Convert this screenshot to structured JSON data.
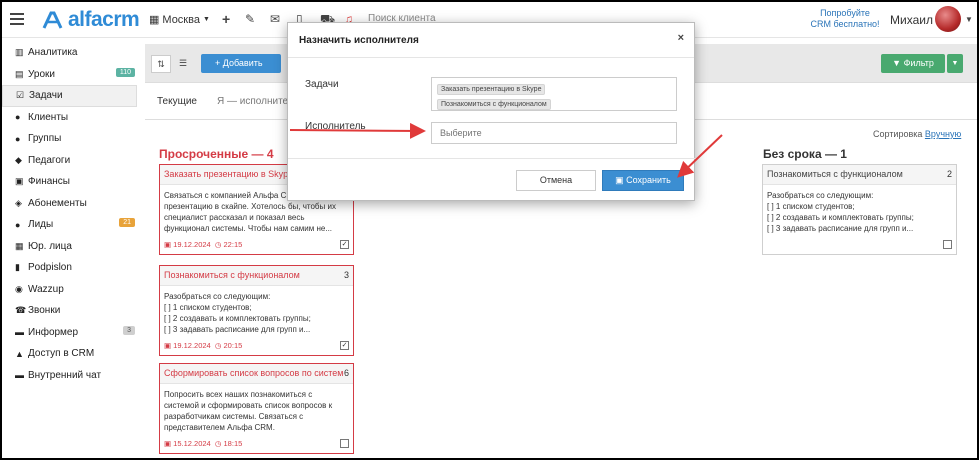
{
  "topbar": {
    "brand": "alfacrm",
    "city": "Москва",
    "search_placeholder": "Поиск клиента",
    "promo_line1": "Попробуйте",
    "promo_line2": "CRM бесплатно!",
    "user_name": "Михаил"
  },
  "sidebar": {
    "items": [
      {
        "label": "Аналитика",
        "icon": "chart-icon"
      },
      {
        "label": "Уроки",
        "icon": "book-icon",
        "badge": "110"
      },
      {
        "label": "Задачи",
        "icon": "tasks-icon"
      },
      {
        "label": "Клиенты",
        "icon": "user-icon"
      },
      {
        "label": "Группы",
        "icon": "users-icon"
      },
      {
        "label": "Педагоги",
        "icon": "teacher-icon"
      },
      {
        "label": "Финансы",
        "icon": "money-icon"
      },
      {
        "label": "Абонементы",
        "icon": "tag-icon"
      },
      {
        "label": "Лиды",
        "icon": "lead-icon",
        "badge": "21"
      },
      {
        "label": "Юр. лица",
        "icon": "building-icon"
      },
      {
        "label": "Podpislon",
        "icon": "doc-icon"
      },
      {
        "label": "Wazzup",
        "icon": "whatsapp-icon"
      },
      {
        "label": "Звонки",
        "icon": "phone-icon"
      },
      {
        "label": "Информер",
        "icon": "informer-icon",
        "badge": "3"
      },
      {
        "label": "Доступ в CRM",
        "icon": "lock-icon"
      },
      {
        "label": "Внутренний чат",
        "icon": "chat-icon"
      }
    ]
  },
  "toolbar": {
    "add_label": "+ Добавить",
    "filter_label": "Фильтр"
  },
  "tabs": {
    "current": "Текущие",
    "assigned": "Я — исполнитель"
  },
  "board": {
    "sort_label": "Сортировка",
    "sort_value": "Вручную",
    "overdue_title": "Просроченные — 4",
    "nodeadline_title": "Без срока — 1",
    "overdue_cards": [
      {
        "title": "Заказать презентацию в Skype",
        "count": "",
        "lines": [
          "Связаться с компанией Альфа CRM",
          "презентацию в скайпе. Хотелось бы, чтобы их",
          "специалист рассказал и показал весь",
          "функционал системы. Чтобы нам самим не..."
        ],
        "date": "19.12.2024",
        "time": "22:15",
        "checked": "✓"
      },
      {
        "title": "Познакомиться с функционалом",
        "count": "3",
        "lines": [
          "Разобраться со следующим:",
          "[ ] 1 списком студентов;",
          "[ ] 2 создавать и комплектовать группы;",
          "[ ] 3 задавать расписание для групп и..."
        ],
        "date": "19.12.2024",
        "time": "20:15",
        "checked": "✓"
      },
      {
        "title": "Сформировать список вопросов по системе",
        "count": "6",
        "lines": [
          "Попросить всех наших познакомиться с",
          "системой и сформировать список вопросов к",
          "разработчикам системы. Связаться с",
          "представителем Альфа CRM."
        ],
        "date": "15.12.2024",
        "time": "18:15",
        "checked": ""
      }
    ],
    "nodeadline_card": {
      "title": "Познакомиться с функционалом",
      "count": "2",
      "lines": [
        "Разобраться со следующим:",
        "[ ] 1 списком студентов;",
        "[ ] 2 создавать и комплектовать группы;",
        "[ ] 3 задавать расписание для групп и..."
      ]
    }
  },
  "modal": {
    "title": "Назначить исполнителя",
    "close": "×",
    "tasks_label": "Задачи",
    "tasks": [
      "Заказать презентацию в Skype",
      "Познакомиться с функционалом"
    ],
    "executor_label": "Исполнитель",
    "executor_placeholder": "Выберите",
    "cancel_label": "Отмена",
    "save_label": "Сохранить"
  },
  "colors": {
    "accent": "#3b8ed2",
    "overdue": "#d43b45",
    "filter": "#49a96f",
    "annotation_arrow": "#e03a3a"
  }
}
